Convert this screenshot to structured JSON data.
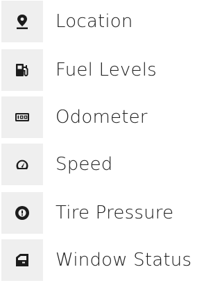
{
  "items": [
    {
      "label": "Location",
      "icon": "location-pin-icon"
    },
    {
      "label": "Fuel Levels",
      "icon": "fuel-pump-icon"
    },
    {
      "label": "Odometer",
      "icon": "odometer-icon"
    },
    {
      "label": "Speed",
      "icon": "speedometer-icon"
    },
    {
      "label": "Tire Pressure",
      "icon": "tire-pressure-icon"
    },
    {
      "label": "Window Status",
      "icon": "window-status-icon"
    }
  ],
  "colors": {
    "tile": "#efefef",
    "icon": "#1c1c1c",
    "text": "#1c1c1c"
  }
}
